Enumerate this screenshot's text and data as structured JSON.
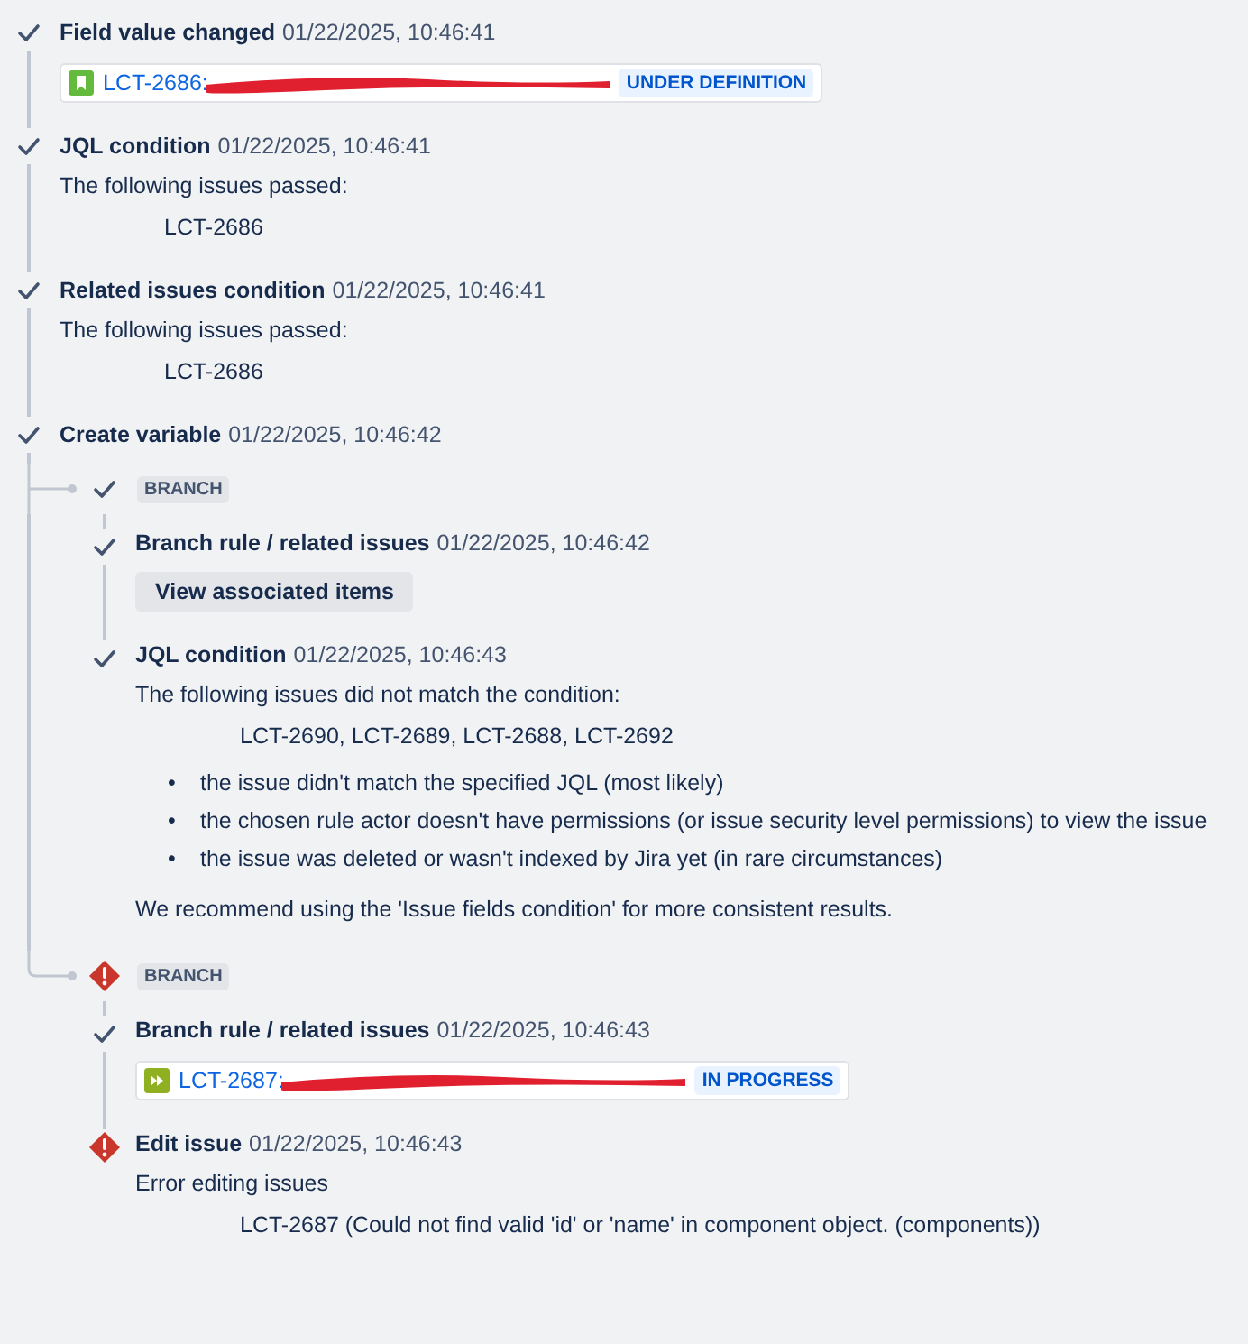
{
  "steps": [
    {
      "failed": false,
      "title": "Field value changed",
      "time": "01/22/2025, 10:46:41",
      "body": [
        {
          "kind": "issue",
          "issue_icon": {
            "kind": "story"
          },
          "key": "LCT-2686:",
          "status": "UNDER DEFINITION"
        }
      ]
    },
    {
      "failed": false,
      "title": "JQL condition",
      "time": "01/22/2025, 10:46:41",
      "body": [
        {
          "kind": "text",
          "text": "The following issues passed:"
        },
        {
          "kind": "indented",
          "text": "LCT-2686"
        }
      ]
    },
    {
      "failed": false,
      "title": "Related issues condition",
      "time": "01/22/2025, 10:46:41",
      "body": [
        {
          "kind": "text",
          "text": "The following issues passed:"
        },
        {
          "kind": "indented",
          "text": "LCT-2686"
        }
      ]
    },
    {
      "failed": false,
      "title": "Create variable",
      "time": "01/22/2025, 10:46:42"
    }
  ],
  "branches": [
    {
      "failed": false,
      "label": "BRANCH",
      "steps": [
        {
          "failed": false,
          "title": "Branch rule / related issues",
          "time": "01/22/2025, 10:46:42",
          "body": [
            {
              "kind": "button",
              "text": "View associated items"
            }
          ]
        },
        {
          "failed": false,
          "title": "JQL condition",
          "time": "01/22/2025, 10:46:43",
          "body": [
            {
              "kind": "text",
              "text": "The following issues did not match the condition:"
            },
            {
              "kind": "indented",
              "text": "LCT-2690, LCT-2689, LCT-2688, LCT-2692"
            },
            {
              "kind": "bullets",
              "items": [
                {
                  "marker": "•",
                  "text": "the issue didn't match the specified JQL (most likely)"
                },
                {
                  "marker": "•",
                  "text": "the chosen rule actor doesn't have permissions (or issue security level permissions) to view the issue"
                },
                {
                  "marker": "•",
                  "text": "the issue was deleted or wasn't indexed by Jira yet (in rare circumstances)"
                }
              ]
            },
            {
              "kind": "text",
              "text": "We recommend using the 'Issue fields condition' for more consistent results."
            }
          ]
        }
      ]
    },
    {
      "failed": true,
      "label": "BRANCH",
      "steps": [
        {
          "failed": false,
          "title": "Branch rule / related issues",
          "time": "01/22/2025, 10:46:43",
          "body": [
            {
              "kind": "issue",
              "issue_icon": {
                "kind": "subtask"
              },
              "key": "LCT-2687:",
              "status": "IN PROGRESS"
            }
          ]
        },
        {
          "failed": true,
          "title": "Edit issue",
          "time": "01/22/2025, 10:46:43",
          "body": [
            {
              "kind": "text",
              "text": "Error editing issues"
            },
            {
              "kind": "indented",
              "text": "LCT-2687 (Could not find valid 'id' or 'name' in component object. (components))"
            }
          ]
        }
      ]
    }
  ]
}
